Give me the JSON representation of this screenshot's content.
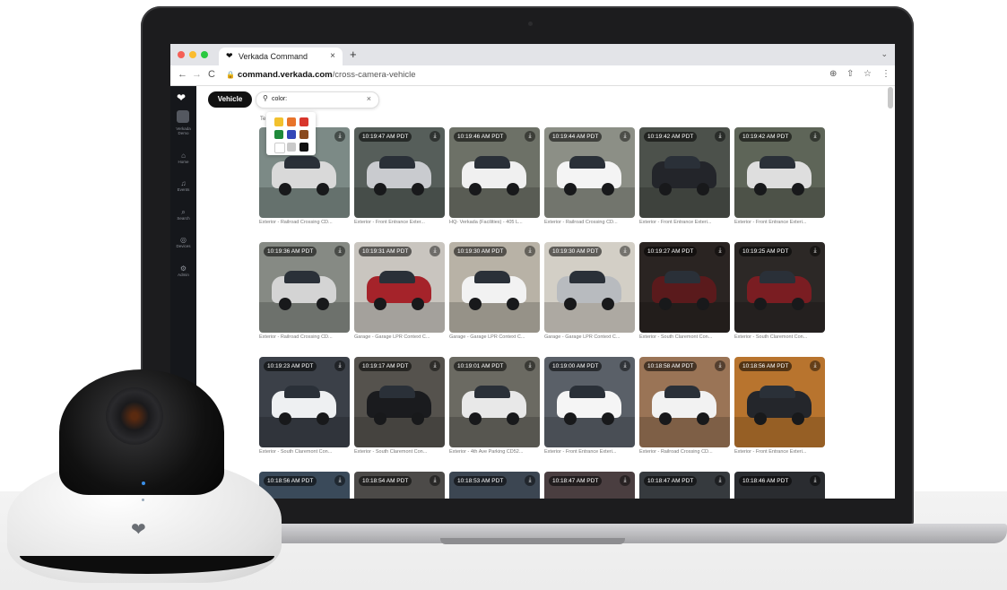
{
  "browser": {
    "tab_title": "Verkada Command",
    "tab_close": "×",
    "new_tab": "+",
    "url_domain": "command.verkada.com",
    "url_path": "/cross-camera-vehicle",
    "back": "←",
    "forward": "→",
    "reload": "C",
    "menu_chevron": "⌄"
  },
  "sidebar": {
    "org": "Verkada Demo",
    "items": [
      {
        "label": "Home",
        "icon": "⌂"
      },
      {
        "label": "Events",
        "icon": "♫"
      },
      {
        "label": "Search",
        "icon": "⌕"
      },
      {
        "label": "Devices",
        "icon": "◎"
      },
      {
        "label": "Admin",
        "icon": "⚙"
      }
    ]
  },
  "toolbar": {
    "vehicle_button": "Vehicle",
    "search_value": "color:",
    "clear": "×",
    "hint_prefix": "Te"
  },
  "palette": [
    "#f2c12e",
    "#e8742a",
    "#d8362c",
    "#1f8a3b",
    "#3347b8",
    "#8a4a1e",
    "#ffffff",
    "#c9c9c9",
    "#111111"
  ],
  "cards": [
    {
      "time": "",
      "caption": "Exterior - Railroad Crossing CD...",
      "color": "#d9d9d9",
      "bg": "#7c8a86"
    },
    {
      "time": "10:19:47 AM PDT",
      "caption": "Exterior - Front Entrance Exter...",
      "color": "#c9cbcf",
      "bg": "#565e5a"
    },
    {
      "time": "10:19:46 AM PDT",
      "caption": "HQ- Verkada (Facilities) - 405 L...",
      "color": "#f0f0f0",
      "bg": "#6d7167"
    },
    {
      "time": "10:19:44 AM PDT",
      "caption": "Exterior - Railroad Crossing CD...",
      "color": "#f4f4f4",
      "bg": "#8c8f86"
    },
    {
      "time": "10:19:42 AM PDT",
      "caption": "Exterior - Front Entrance Exteri...",
      "color": "#23252a",
      "bg": "#4c514b"
    },
    {
      "time": "10:19:42 AM PDT",
      "caption": "Exterior - Front Entrance Exteri...",
      "color": "#dedede",
      "bg": "#5e6558"
    },
    {
      "time": "10:19:36 AM PDT",
      "caption": "Exterior - Railroad Crossing CD...",
      "color": "#d4d4d4",
      "bg": "#868a84"
    },
    {
      "time": "10:19:31 AM PDT",
      "caption": "Garage - Garage LPR Context C...",
      "color": "#a5232a",
      "bg": "#c9c5bf"
    },
    {
      "time": "10:19:30 AM PDT",
      "caption": "Garage - Garage LPR Context C...",
      "color": "#f2f2f2",
      "bg": "#b8b2a6"
    },
    {
      "time": "10:19:30 AM PDT",
      "caption": "Garage - Garage LPR Context C...",
      "color": "#b8bbbf",
      "bg": "#d3cfc6"
    },
    {
      "time": "10:19:27 AM PDT",
      "caption": "Exterior - South Claremont Con...",
      "color": "#5a1a1c",
      "bg": "#2a2422"
    },
    {
      "time": "10:19:25 AM PDT",
      "caption": "Exterior - South Claremont Con...",
      "color": "#7a1d22",
      "bg": "#2c2826"
    },
    {
      "time": "10:19:23 AM PDT",
      "caption": "Exterior - South Claremont Con...",
      "color": "#eef0f2",
      "bg": "#3b4048"
    },
    {
      "time": "10:19:17 AM PDT",
      "caption": "Exterior - South Claremont Con...",
      "color": "#1a1b1e",
      "bg": "#55524d"
    },
    {
      "time": "10:19:01 AM PDT",
      "caption": "Exterior - 4th Ave Parking CD52...",
      "color": "#e8e8e8",
      "bg": "#6b6a62"
    },
    {
      "time": "10:19:00 AM PDT",
      "caption": "Exterior - Front Entrance Exteri...",
      "color": "#f5f5f5",
      "bg": "#5a6068"
    },
    {
      "time": "10:18:58 AM PDT",
      "caption": "Exterior - Railroad Crossing CD...",
      "color": "#f2f2f2",
      "bg": "#9a7456"
    },
    {
      "time": "10:18:56 AM PDT",
      "caption": "Exterior - Front Entrance Exteri...",
      "color": "#24262b",
      "bg": "#b8742e"
    },
    {
      "time": "10:18:56 AM PDT",
      "caption": "",
      "color": "#5c6a78",
      "bg": "#3a4a5a"
    },
    {
      "time": "10:18:54 AM PDT",
      "caption": "",
      "color": "#6e6a66",
      "bg": "#4c4a48"
    },
    {
      "time": "10:18:53 AM PDT",
      "caption": "",
      "color": "#4a5662",
      "bg": "#3c4652"
    },
    {
      "time": "10:18:47 AM PDT",
      "caption": "",
      "color": "#a8262a",
      "bg": "#4a3e40"
    },
    {
      "time": "10:18:47 AM PDT",
      "caption": "",
      "color": "#2a2c30",
      "bg": "#363a3e"
    },
    {
      "time": "10:18:46 AM PDT",
      "caption": "",
      "color": "#1d1f24",
      "bg": "#2a2c30"
    }
  ]
}
